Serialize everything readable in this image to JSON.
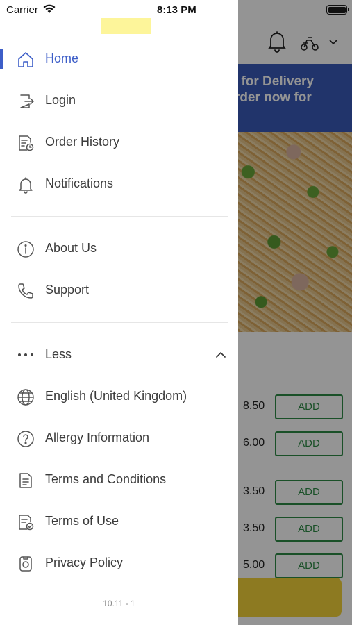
{
  "status_bar": {
    "carrier": "Carrier",
    "time": "8:13 PM"
  },
  "background": {
    "banner_line1": "ed for Delivery",
    "banner_line2": "-order now for",
    "menu_rows": [
      {
        "price": "8.50",
        "add_label": "ADD"
      },
      {
        "price": "6.00",
        "add_label": "ADD"
      },
      {
        "price": "3.50",
        "add_label": "ADD"
      },
      {
        "price": "3.50",
        "add_label": "ADD"
      },
      {
        "price": "5.00",
        "add_label": "ADD"
      }
    ]
  },
  "drawer": {
    "primary": [
      {
        "label": "Home",
        "icon": "home-icon",
        "active": true
      },
      {
        "label": "Login",
        "icon": "login-icon"
      },
      {
        "label": "Order History",
        "icon": "order-history-icon"
      },
      {
        "label": "Notifications",
        "icon": "bell-icon"
      }
    ],
    "secondary": [
      {
        "label": "About Us",
        "icon": "info-icon"
      },
      {
        "label": "Support",
        "icon": "phone-icon"
      }
    ],
    "more": {
      "label": "Less",
      "icon": "more-dots-icon"
    },
    "tertiary": [
      {
        "label": "English (United Kingdom)",
        "icon": "globe-icon"
      },
      {
        "label": "Allergy Information",
        "icon": "question-icon"
      },
      {
        "label": "Terms and Conditions",
        "icon": "document-icon"
      },
      {
        "label": "Terms of Use",
        "icon": "document-check-icon"
      },
      {
        "label": "Privacy Policy",
        "icon": "privacy-icon"
      }
    ],
    "version": "10.11 - 1"
  },
  "colors": {
    "accent": "#3d5ec8",
    "banner": "#3a5bb8",
    "add_green": "#2e8b46",
    "cart": "#f3d23a"
  }
}
